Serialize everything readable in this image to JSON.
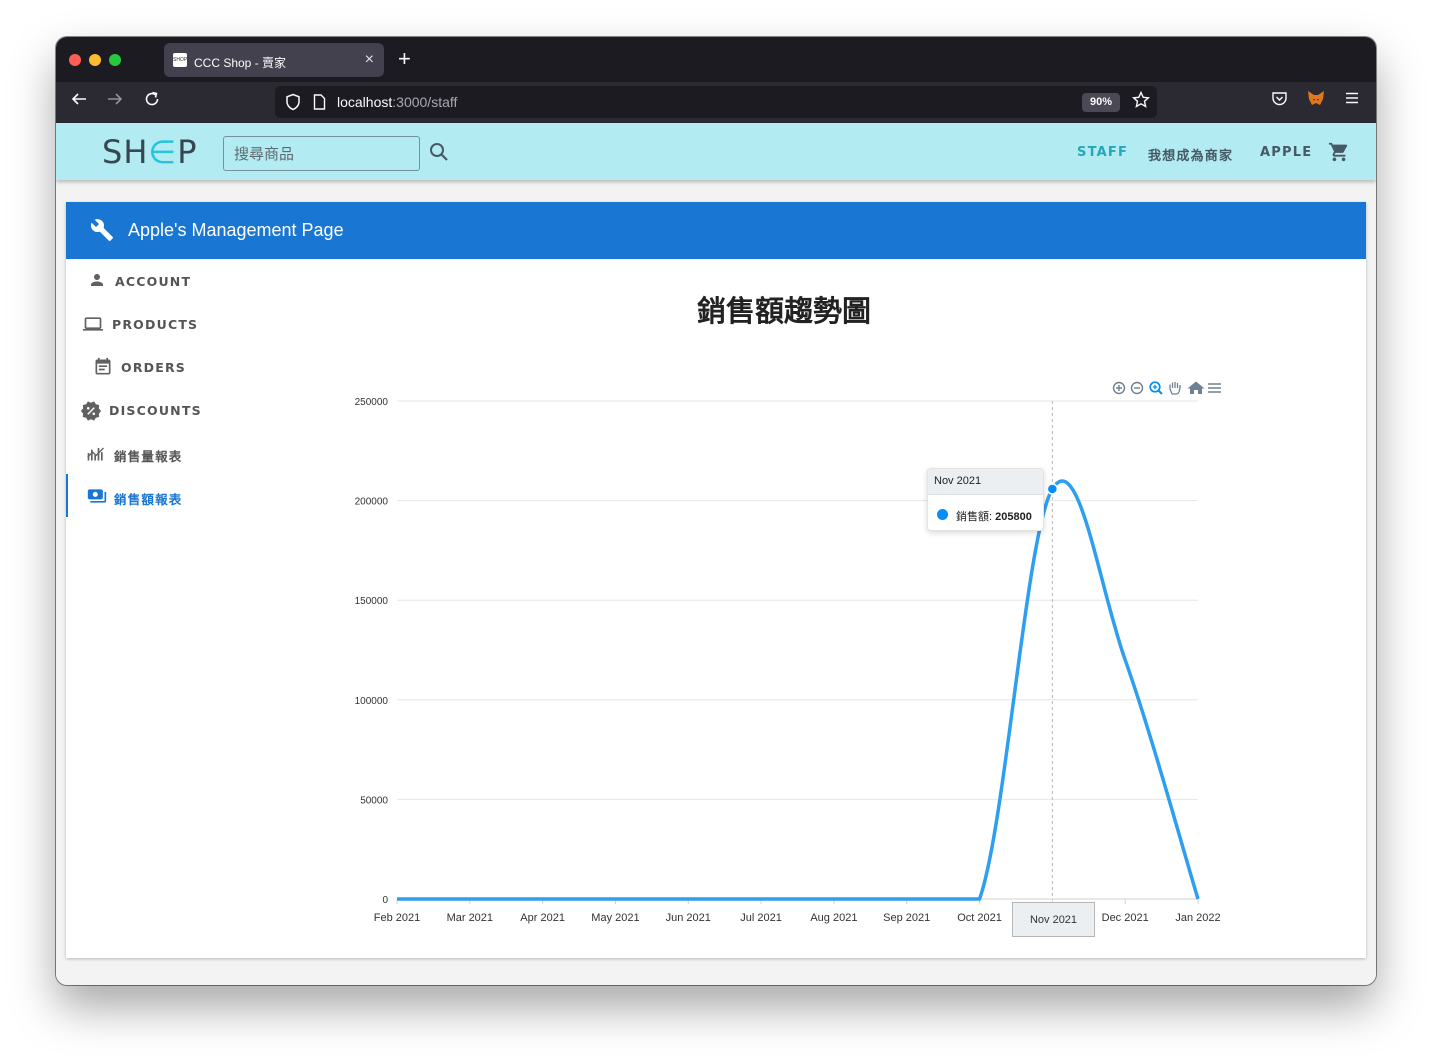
{
  "browser": {
    "tab_title": "CCC Shop - 賣家",
    "url_host": "localhost",
    "url_path": ":3000/staff",
    "zoom": "90%"
  },
  "header": {
    "logo": "SHOP",
    "search_placeholder": "搜尋商品",
    "nav": [
      "STAFF",
      "我想成為商家",
      "APPLE"
    ]
  },
  "page": {
    "title": "Apple's Management Page"
  },
  "sidebar": {
    "items": [
      {
        "label": "ACCOUNT",
        "icon": "person-icon"
      },
      {
        "label": "PRODUCTS",
        "icon": "laptop-icon"
      },
      {
        "label": "ORDERS",
        "icon": "calendar-icon"
      },
      {
        "label": "DISCOUNTS",
        "icon": "discount-icon"
      },
      {
        "label": "銷售量報表",
        "icon": "chart-icon"
      },
      {
        "label": "銷售額報表",
        "icon": "money-icon",
        "active": true
      }
    ]
  },
  "chart_data": {
    "type": "line",
    "title": "銷售額趨勢圖",
    "categories": [
      "Feb 2021",
      "Mar 2021",
      "Apr 2021",
      "May 2021",
      "Jun 2021",
      "Jul 2021",
      "Aug 2021",
      "Sep 2021",
      "Oct 2021",
      "Nov 2021",
      "Dec 2021",
      "Jan 2022"
    ],
    "series": [
      {
        "name": "銷售額",
        "values": [
          0,
          0,
          0,
          0,
          0,
          0,
          0,
          0,
          0,
          205800,
          120000,
          0
        ]
      }
    ],
    "ylim": [
      0,
      250000
    ],
    "yticks": [
      "0",
      "50000",
      "100000",
      "150000",
      "200000",
      "250000"
    ],
    "grid": true,
    "line_color": "#2e9ff0",
    "tooltip": {
      "category": "Nov 2021",
      "label": "銷售額:",
      "value": "205800"
    }
  }
}
